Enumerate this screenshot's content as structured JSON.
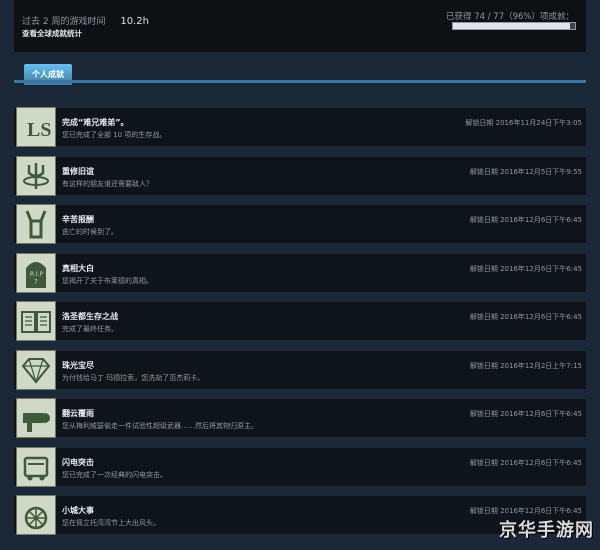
{
  "stats": {
    "playtime_label": "过去 2 周的游戏时间",
    "playtime_value": "10.2h",
    "global_link": "查看全球成就统计",
    "progress_text": "已获得 74 / 77（96%）项成就：",
    "progress_fraction": 0.96
  },
  "tabs": [
    {
      "label": "个人成就"
    }
  ],
  "achievements": [
    {
      "title": "完成“难兄难弟”。",
      "desc": "您已完成了全部 10 项的生存战。",
      "date": "解锁日期 2016年11月24日下午3:05",
      "icon": "ls-emblem-icon"
    },
    {
      "title": "重修旧谊",
      "desc": "有这样的朋友谁还需要敌人？",
      "date": "解锁日期 2016年12月5日下午9:55",
      "icon": "trident-icon"
    },
    {
      "title": "辛苦报酬",
      "desc": "逃亡的时候到了。",
      "date": "解锁日期 2016年12月6日下午6:45",
      "icon": "hands-up-icon"
    },
    {
      "title": "真相大白",
      "desc": "您揭开了关于布莱德的真相。",
      "date": "解锁日期 2016年12月6日下午6:45",
      "icon": "tombstone-icon"
    },
    {
      "title": "洛圣都生存之战",
      "desc": "完成了最终任务。",
      "date": "解锁日期 2016年12月6日下午6:45",
      "icon": "book-icon"
    },
    {
      "title": "珠光宝尽",
      "desc": "为付钱给马丁·玛德拉索，您洗劫了范杰莉卡。",
      "date": "解锁日期 2016年12月2日上午7:15",
      "icon": "diamond-icon"
    },
    {
      "title": "翻云覆雨",
      "desc": "您从梅利威瑟偷走一件试验性超级武器……然后将其物归原主。",
      "date": "解锁日期 2016年12月6日下午6:45",
      "icon": "weapon-icon"
    },
    {
      "title": "闪电突击",
      "desc": "您已完成了一次经典的闪电突击。",
      "date": "解锁日期 2016年12月6日下午6:45",
      "icon": "truck-icon"
    },
    {
      "title": "小城大事",
      "desc": "您在佩立托湾湾节上大出风头。",
      "date": "解锁日期 2016年12月6日下午6:45",
      "icon": "wheel-icon"
    }
  ],
  "watermark": "京华手游网"
}
